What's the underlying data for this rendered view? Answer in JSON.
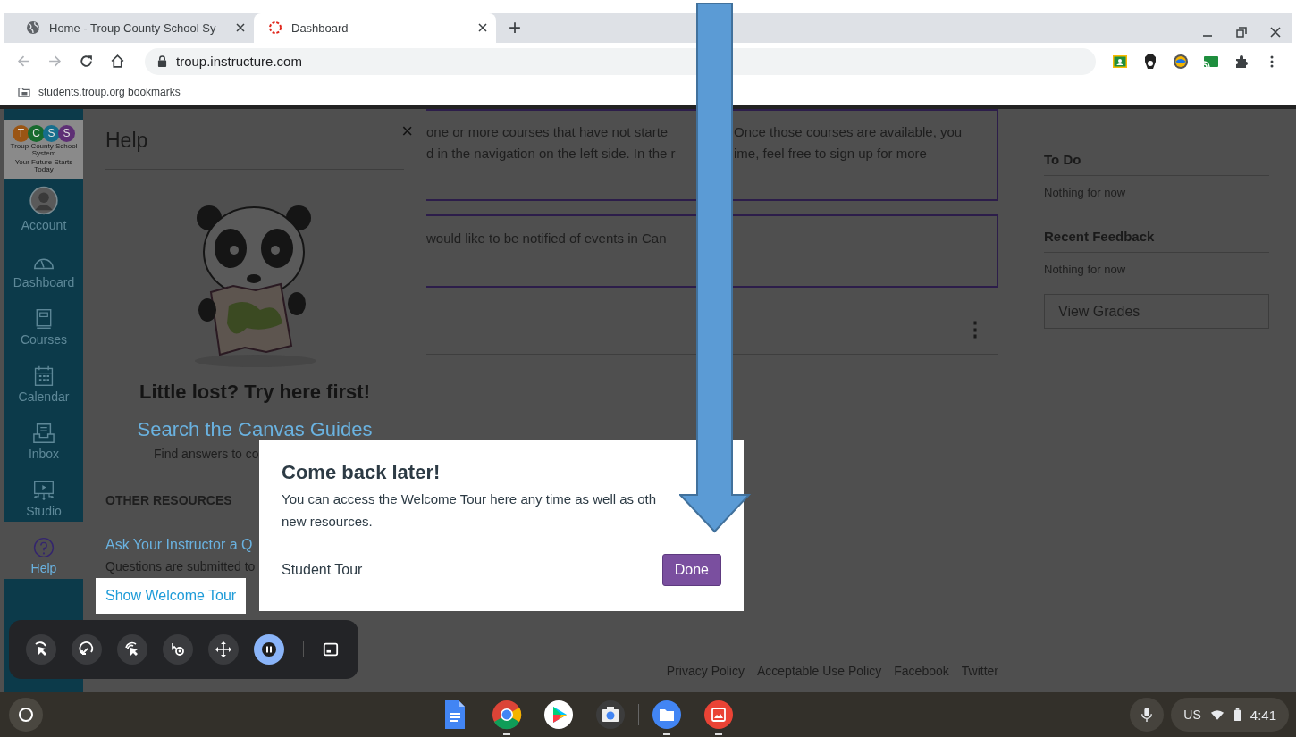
{
  "browser": {
    "tabs": [
      {
        "title": "Home - Troup County School Sy",
        "kind": "globe",
        "selected": false
      },
      {
        "title": "Dashboard",
        "kind": "canvas",
        "selected": true
      }
    ],
    "new_tab": "+",
    "address": "troup.instructure.com",
    "extensions": [
      {
        "kind": "classroom"
      },
      {
        "kind": "agent"
      },
      {
        "kind": "eye"
      },
      {
        "kind": "cast"
      },
      {
        "kind": "puzzle"
      }
    ],
    "bookmarks": [
      {
        "label": "students.troup.org bookmarks"
      }
    ]
  },
  "nav": {
    "logo": {
      "letters": [
        "T",
        "C",
        "S",
        "S"
      ],
      "name": "Troup County School System",
      "tagline": "Your Future Starts Today"
    },
    "items": [
      {
        "label": "Account",
        "kind": "account",
        "selected": false
      },
      {
        "label": "Dashboard",
        "kind": "dashboard",
        "selected": false
      },
      {
        "label": "Courses",
        "kind": "courses",
        "selected": false
      },
      {
        "label": "Calendar",
        "kind": "calendar",
        "selected": false
      },
      {
        "label": "Inbox",
        "kind": "inbox",
        "selected": false
      },
      {
        "label": "Studio",
        "kind": "studio",
        "selected": false
      },
      {
        "label": "Help",
        "kind": "help",
        "selected": true
      }
    ]
  },
  "help_tray": {
    "title": "Help",
    "close": "×",
    "heading": "Little lost? Try here first!",
    "guides_link": "Search the Canvas Guides",
    "guides_text": "Find answers to co",
    "section_title": "OTHER RESOURCES",
    "resources": [
      {
        "title": "Ask Your Instructor a Q",
        "text": "Questions are submitted to"
      }
    ],
    "welcome_tour": "Show Welcome Tour"
  },
  "dashboard": {
    "cards": [
      {
        "lines": [
          [
            "one or more courses that have not starte",
            "Once those courses are available, you"
          ],
          [
            "d in the navigation on the left side. In the r",
            "ime, feel free to sign up for more"
          ]
        ]
      },
      {
        "lines": [
          [
            "would like to be notified of events in Can"
          ]
        ]
      }
    ],
    "menu": "⋮",
    "footer_links": [
      "Privacy Policy",
      "Acceptable Use Policy",
      "Facebook",
      "Twitter"
    ]
  },
  "sidebar": {
    "sections": [
      {
        "title": "To Do",
        "text": "Nothing for now"
      },
      {
        "title": "Recent Feedback",
        "text": "Nothing for now"
      }
    ],
    "button": "View Grades"
  },
  "popover": {
    "title": "Come back later!",
    "lines": [
      "You can access the Welcome Tour here any time as well as oth",
      "new resources."
    ],
    "tour": "Student Tour",
    "button": "Done"
  },
  "capture_toolbar": {
    "buttons": [
      {
        "kind": "cursor",
        "selected": false
      },
      {
        "kind": "loop",
        "selected": false
      },
      {
        "kind": "click",
        "selected": false
      },
      {
        "kind": "rotate",
        "selected": false
      },
      {
        "kind": "move",
        "selected": false
      },
      {
        "kind": "pause",
        "selected": true
      }
    ]
  },
  "shelf": {
    "apps": [
      {
        "kind": "docs",
        "running": false
      },
      {
        "kind": "chrome",
        "running": true
      },
      {
        "kind": "play",
        "running": false
      },
      {
        "kind": "camera",
        "running": false
      },
      {
        "kind": "files",
        "running": true
      },
      {
        "kind": "gallery",
        "running": true
      }
    ],
    "ime": "US",
    "time": "4:41"
  }
}
